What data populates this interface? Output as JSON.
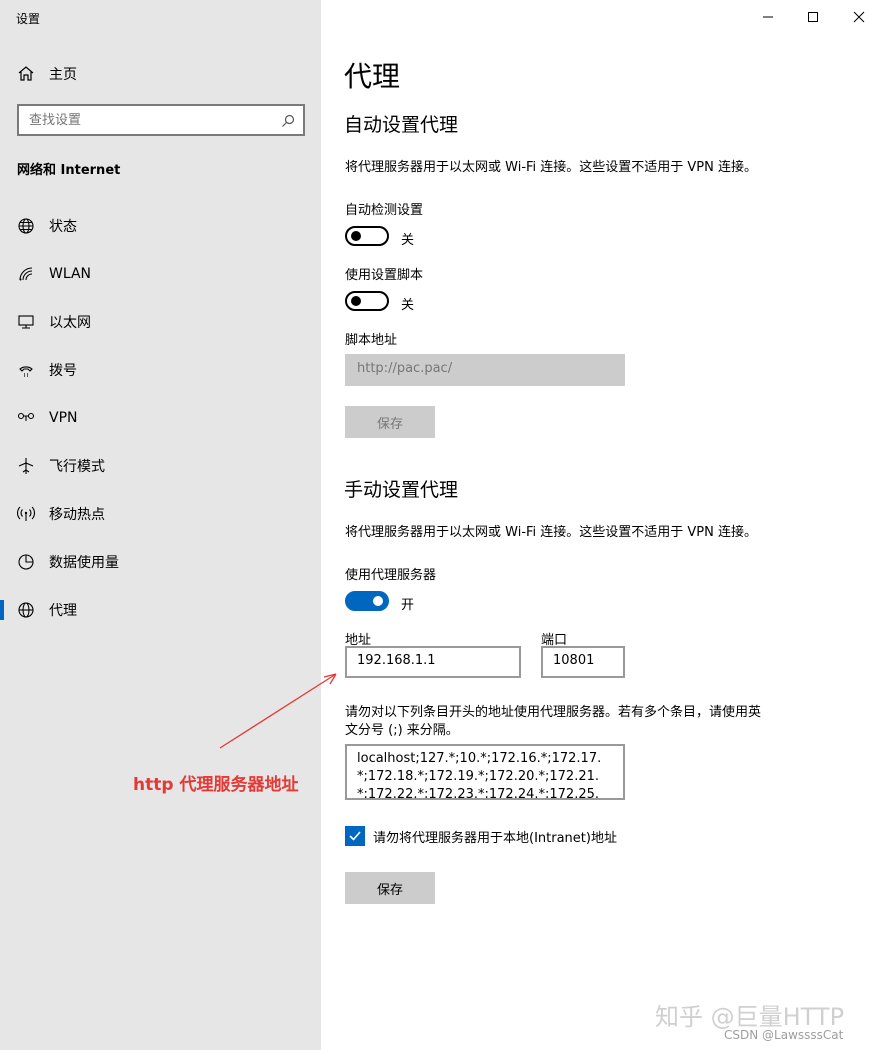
{
  "window": {
    "title": "设置"
  },
  "sidebar": {
    "home_label": "主页",
    "search_placeholder": "查找设置",
    "section_title": "网络和 Internet",
    "items": [
      {
        "label": "状态",
        "icon": "globe-status-icon"
      },
      {
        "label": "WLAN",
        "icon": "wifi-icon"
      },
      {
        "label": "以太网",
        "icon": "ethernet-icon"
      },
      {
        "label": "拨号",
        "icon": "dialup-icon"
      },
      {
        "label": "VPN",
        "icon": "vpn-icon"
      },
      {
        "label": "飞行模式",
        "icon": "airplane-icon"
      },
      {
        "label": "移动热点",
        "icon": "hotspot-icon"
      },
      {
        "label": "数据使用量",
        "icon": "data-usage-icon"
      },
      {
        "label": "代理",
        "icon": "globe-icon",
        "active": true
      }
    ]
  },
  "main": {
    "page_title": "代理",
    "auto": {
      "heading": "自动设置代理",
      "description": "将代理服务器用于以太网或 Wi-Fi 连接。这些设置不适用于 VPN 连接。",
      "detect_label": "自动检测设置",
      "detect_state": "关",
      "script_label": "使用设置脚本",
      "script_state": "关",
      "address_label": "脚本地址",
      "address_value": "http://pac.pac/",
      "save_label": "保存"
    },
    "manual": {
      "heading": "手动设置代理",
      "description": "将代理服务器用于以太网或 Wi-Fi 连接。这些设置不适用于 VPN 连接。",
      "use_proxy_label": "使用代理服务器",
      "use_proxy_state": "开",
      "address_label": "地址",
      "address_value": "192.168.1.1",
      "port_label": "端口",
      "port_value": "10801",
      "exceptions_hint_line1": "请勿对以下列条目开头的地址使用代理服务器。若有多个条目，请使用英",
      "exceptions_hint_line2": "文分号 (;) 来分隔。",
      "exceptions_line1": "localhost;127.*;10.*;172.16.*;172.17.",
      "exceptions_line2": "*;172.18.*;172.19.*;172.20.*;172.21.",
      "exceptions_line3": "*;172.22.*;172.23.*;172.24.*;172.25.",
      "bypass_local_label": "请勿将代理服务器用于本地(Intranet)地址",
      "bypass_local_checked": true,
      "save_label": "保存"
    }
  },
  "annotation": {
    "text": "http 代理服务器地址",
    "color": "#e53935"
  },
  "watermark": {
    "line1": "知乎 @巨量HTTP",
    "line2": "CSDN @LawssssCat"
  },
  "colors": {
    "accent": "#0067c0",
    "sidebar_bg": "#e6e6e6"
  }
}
